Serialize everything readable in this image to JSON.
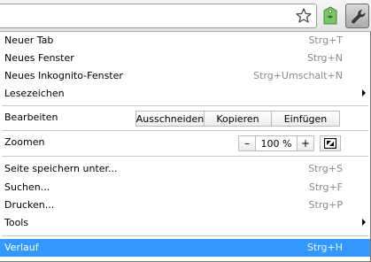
{
  "toolbar": {
    "icons": [
      "star-icon",
      "extension-tag-icon",
      "wrench-icon"
    ]
  },
  "menu": {
    "new_tab": {
      "label": "Neuer Tab",
      "shortcut": "Strg+T"
    },
    "new_window": {
      "label": "Neues Fenster",
      "shortcut": "Strg+N"
    },
    "new_incognito": {
      "label": "Neues Inkognito-Fenster",
      "shortcut": "Strg+Umschalt+N"
    },
    "bookmarks": {
      "label": "Lesezeichen"
    },
    "edit": {
      "label": "Bearbeiten",
      "cut": "Ausschneiden",
      "copy": "Kopieren",
      "paste": "Einfügen"
    },
    "zoom": {
      "label": "Zoomen",
      "minus": "–",
      "value": "100 %",
      "plus": "+"
    },
    "save_page": {
      "label": "Seite speichern unter...",
      "shortcut": "Strg+S"
    },
    "find": {
      "label": "Suchen...",
      "shortcut": "Strg+F"
    },
    "print": {
      "label": "Drucken...",
      "shortcut": "Strg+P"
    },
    "tools": {
      "label": "Tools"
    },
    "history": {
      "label": "Verlauf",
      "shortcut": "Strg+H",
      "highlighted": true
    }
  },
  "colors": {
    "highlight": "#3399ff",
    "shortcut_text": "#8a8a8a"
  }
}
